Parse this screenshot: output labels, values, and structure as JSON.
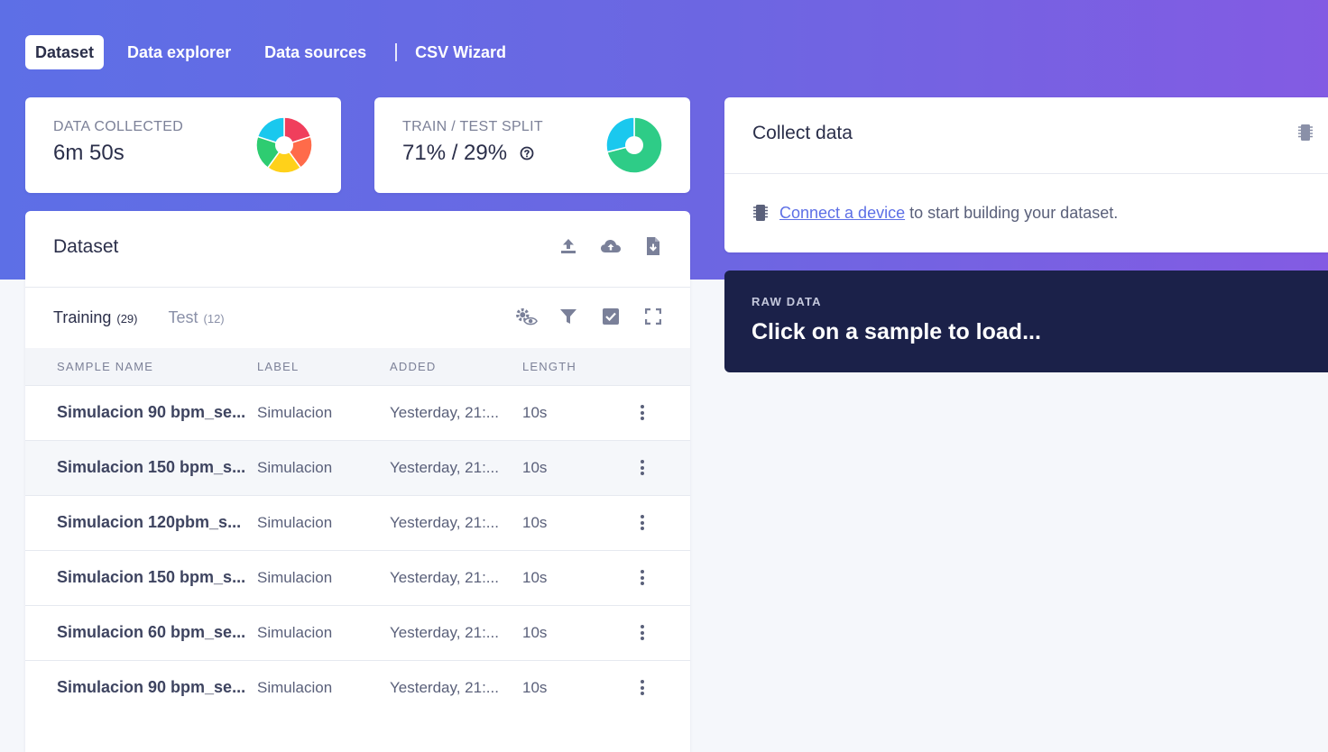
{
  "nav": {
    "tabs": [
      "Dataset",
      "Data explorer",
      "Data sources"
    ],
    "csv_wizard": "CSV Wizard"
  },
  "stats": {
    "collected": {
      "label": "DATA COLLECTED",
      "value": "6m 50s",
      "pie_colors": [
        "#f03e5c",
        "#ff6b4a",
        "#ffd11a",
        "#2ecc71",
        "#1ac8ee"
      ]
    },
    "split": {
      "label": "TRAIN / TEST SPLIT",
      "value": "71% / 29%",
      "train_fraction": 0.71,
      "train_color": "#2ecc87",
      "test_color": "#1ac8ee"
    }
  },
  "dataset": {
    "title": "Dataset",
    "tabs": [
      {
        "label": "Training",
        "count": "(29)"
      },
      {
        "label": "Test",
        "count": "(12)"
      }
    ],
    "columns": [
      "SAMPLE NAME",
      "LABEL",
      "ADDED",
      "LENGTH"
    ],
    "rows": [
      {
        "name": "Simulacion 90 bpm_se...",
        "label": "Simulacion",
        "added": "Yesterday, 21:...",
        "length": "10s"
      },
      {
        "name": "Simulacion 150 bpm_s...",
        "label": "Simulacion",
        "added": "Yesterday, 21:...",
        "length": "10s"
      },
      {
        "name": "Simulacion 120pbm_s...",
        "label": "Simulacion",
        "added": "Yesterday, 21:...",
        "length": "10s"
      },
      {
        "name": "Simulacion 150 bpm_s...",
        "label": "Simulacion",
        "added": "Yesterday, 21:...",
        "length": "10s"
      },
      {
        "name": "Simulacion 60 bpm_se...",
        "label": "Simulacion",
        "added": "Yesterday, 21:...",
        "length": "10s"
      },
      {
        "name": "Simulacion 90 bpm_se...",
        "label": "Simulacion",
        "added": "Yesterday, 21:...",
        "length": "10s"
      }
    ]
  },
  "collect": {
    "title": "Collect data",
    "link_text": "Connect a device",
    "rest_text": "to start building your dataset."
  },
  "raw": {
    "label": "RAW DATA",
    "title": "Click on a sample to load..."
  }
}
